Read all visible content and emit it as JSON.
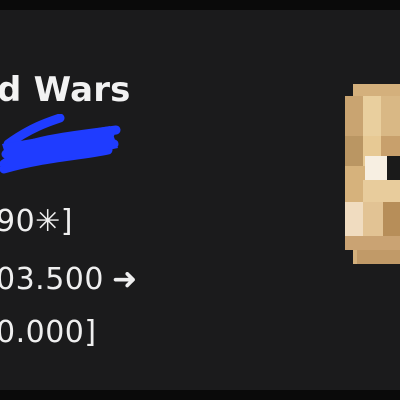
{
  "card": {
    "title": "d Wars",
    "stats": [
      {
        "text": "90✳]"
      },
      {
        "text": "03.500",
        "arrow": "➜"
      },
      {
        "text": "0.000]"
      }
    ]
  },
  "colors": {
    "background": "#0a0a0a",
    "card": "#1b1b1c",
    "scribble": "#1f3cff",
    "text": "#f0f0f0"
  },
  "icons": {
    "star": "asterisk-star-icon",
    "arrow": "right-arrow-icon",
    "avatar": "pixelated-player-head-icon"
  }
}
